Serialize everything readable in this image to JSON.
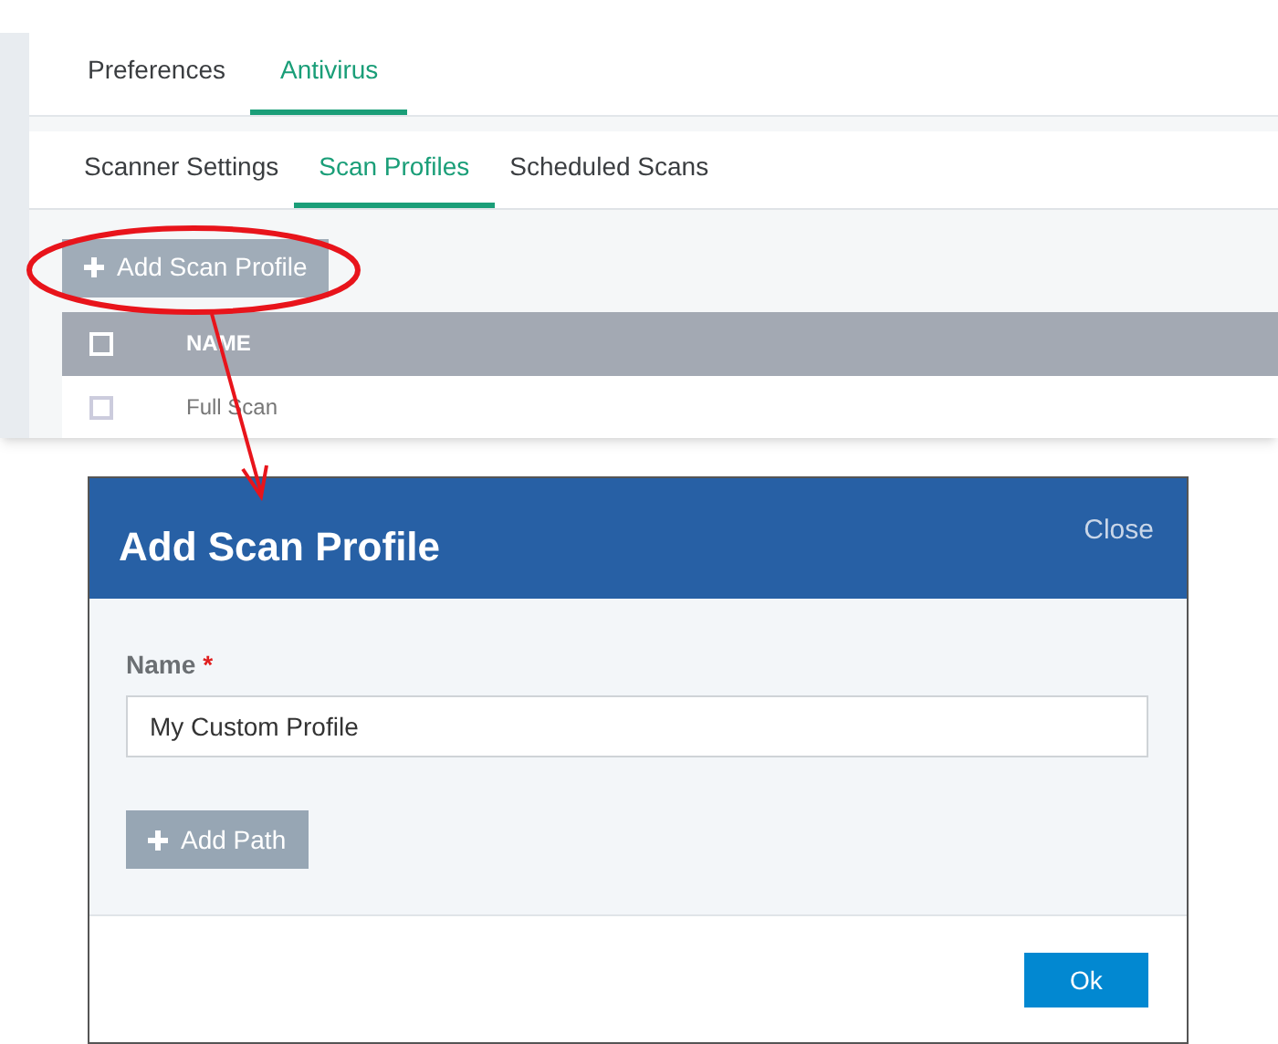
{
  "tabs": [
    {
      "label": "Preferences",
      "selected": false
    },
    {
      "label": "Antivirus",
      "selected": true
    }
  ],
  "subtabs": [
    {
      "label": "Scanner Settings",
      "selected": false
    },
    {
      "label": "Scan Profiles",
      "selected": true
    },
    {
      "label": "Scheduled Scans",
      "selected": false
    }
  ],
  "add_button": {
    "label": "Add Scan Profile"
  },
  "table": {
    "header_checked": false,
    "columns": [
      "NAME"
    ],
    "rows": [
      {
        "name": "Full Scan",
        "checked": false
      }
    ]
  },
  "dialog": {
    "title": "Add Scan Profile",
    "close": "Close",
    "field_label": "Name",
    "required_mark": "*",
    "name_value": "My Custom Profile",
    "add_path": "Add Path",
    "ok": "Ok"
  }
}
